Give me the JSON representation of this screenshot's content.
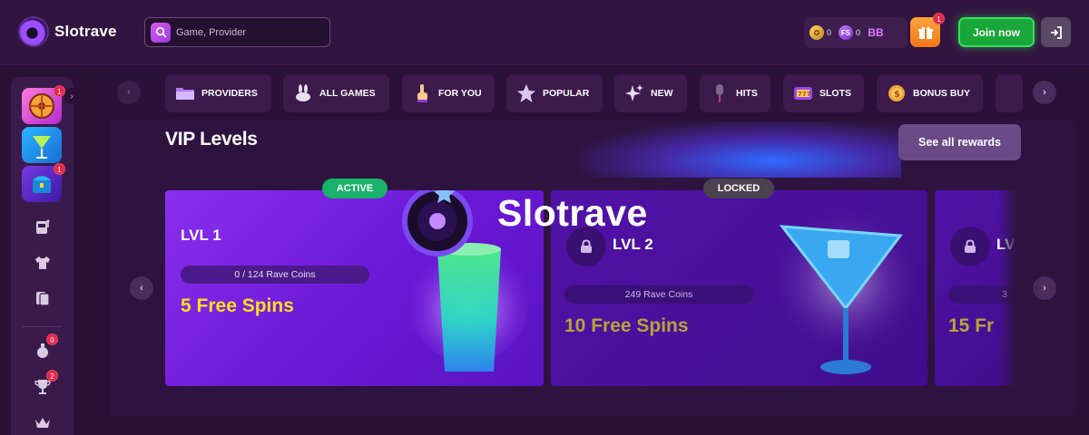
{
  "header": {
    "logo_text": "Slotrave",
    "search_placeholder": "Game, Provider",
    "balances": [
      {
        "icon": "rave-coin-icon",
        "value": "0"
      },
      {
        "icon": "free-spins-icon",
        "value": "0"
      },
      {
        "icon": "bonus-balance-icon",
        "value": ""
      }
    ],
    "gift_badge": "1",
    "join_label": "Join now"
  },
  "sidebar": {
    "thumb_badges": [
      "1",
      "",
      "1"
    ],
    "icon_badges": {
      "bottle": "0",
      "trophy": "2"
    }
  },
  "tabs": [
    {
      "label": "PROVIDERS",
      "icon": "folder-icon"
    },
    {
      "label": "ALL GAMES",
      "icon": "rabbit-icon"
    },
    {
      "label": "FOR YOU",
      "icon": "pointing-hand-icon"
    },
    {
      "label": "POPULAR",
      "icon": "star-icon"
    },
    {
      "label": "NEW",
      "icon": "sparkle-icon"
    },
    {
      "label": "HITS",
      "icon": "microphone-icon"
    },
    {
      "label": "SLOTS",
      "icon": "slot-machine-icon"
    },
    {
      "label": "BONUS BUY",
      "icon": "coin-icon"
    }
  ],
  "vip": {
    "title": "VIP Levels",
    "see_all_label": "See all rewards",
    "watermark": "Slotrave",
    "levels": [
      {
        "status": "ACTIVE",
        "level": "LVL 1",
        "progress": "0 / 124 Rave Coins",
        "reward": "5 Free Spins"
      },
      {
        "status": "LOCKED",
        "level": "LVL 2",
        "progress": "249 Rave Coins",
        "reward": "10 Free Spins"
      },
      {
        "status": "",
        "level": "LV",
        "progress": "3",
        "reward": "15 Fr"
      }
    ]
  },
  "colors": {
    "background": "#2a1035",
    "accent_purple": "#8a2ef0",
    "active_green": "#19b268",
    "join_green": "#36e05a",
    "reward_yellow": "#ffdf1a"
  }
}
